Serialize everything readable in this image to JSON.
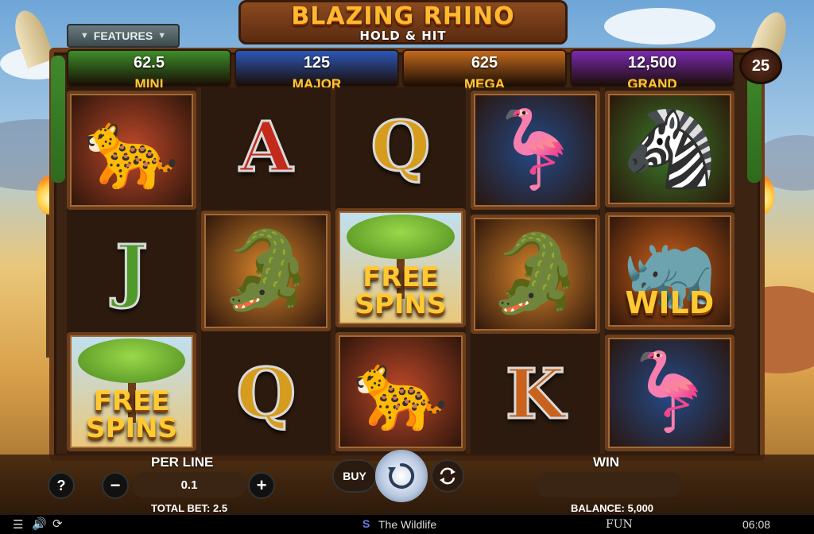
{
  "game": {
    "title": "BLAZING RHINO",
    "subtitle": "HOLD & HIT"
  },
  "features_button": {
    "label": "FEATURES"
  },
  "jackpots": [
    {
      "name": "MINI",
      "value": "62.5",
      "color": "#3c8d2a"
    },
    {
      "name": "MAJOR",
      "value": "125",
      "color": "#2b57b8"
    },
    {
      "name": "MEGA",
      "value": "625",
      "color": "#c46a1c"
    },
    {
      "name": "GRAND",
      "value": "12,500",
      "color": "#7a2ab0"
    }
  ],
  "paylines": "25",
  "reels": [
    [
      {
        "symbol": "cheetah",
        "icon": "🐆"
      },
      {
        "symbol": "J",
        "color": "#4f9a2a"
      },
      {
        "symbol": "free-spins",
        "text": "FREE SPINS"
      }
    ],
    [
      {
        "symbol": "A",
        "color": "#c22a1c"
      },
      {
        "symbol": "crocodile",
        "icon": "🐊"
      },
      {
        "symbol": "Q",
        "color": "#d69c1d"
      }
    ],
    [
      {
        "symbol": "Q",
        "color": "#d69c1d"
      },
      {
        "symbol": "free-spins",
        "text": "FREE SPINS"
      },
      {
        "symbol": "cheetah",
        "icon": "🐆"
      }
    ],
    [
      {
        "symbol": "flamingo",
        "icon": "🦩"
      },
      {
        "symbol": "crocodile",
        "icon": "🐊"
      },
      {
        "symbol": "K",
        "color": "#c8621c"
      }
    ],
    [
      {
        "symbol": "zebra",
        "icon": "🦓"
      },
      {
        "symbol": "wild-rhino",
        "icon": "🦏",
        "text": "WILD"
      },
      {
        "symbol": "flamingo",
        "icon": "🦩"
      }
    ]
  ],
  "controls": {
    "help_label": "?",
    "per_line_label": "PER LINE",
    "per_line_value": "0.1",
    "minus_label": "−",
    "plus_label": "+",
    "buy_label": "BUY",
    "spin_icon": "spin-icon",
    "autoplay_icon": "autoplay-icon",
    "win_label": "WIN",
    "win_value": "",
    "total_bet": "TOTAL BET: 2.5",
    "balance": "BALANCE: 5,000"
  },
  "status_bar": {
    "brand": "The Wildlife",
    "mode": "FUN",
    "time": "06:08"
  }
}
